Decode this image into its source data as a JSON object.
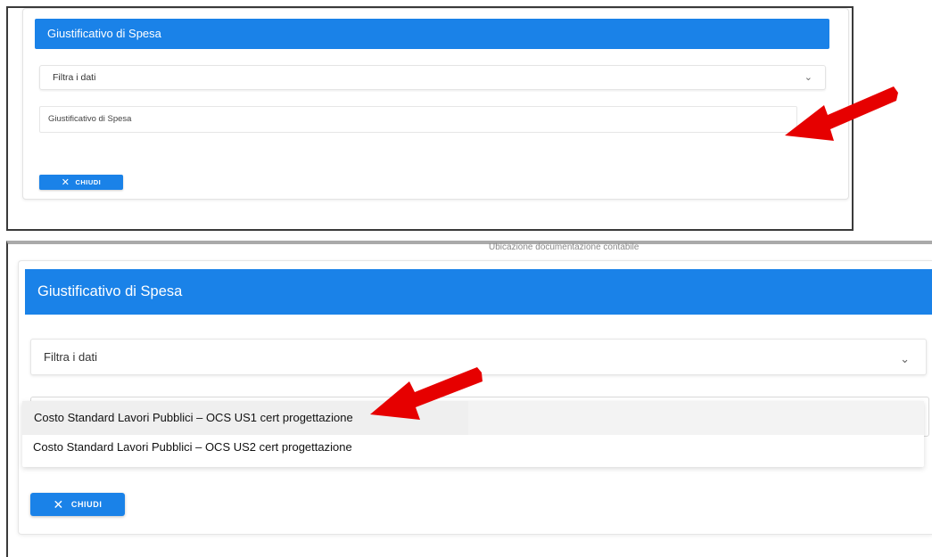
{
  "top_panel": {
    "header_title": "Giustificativo di Spesa",
    "filter_label": "Filtra i dati",
    "select_placeholder": "Giustificativo di Spesa",
    "close_label": "CHIUDI"
  },
  "bottom_panel": {
    "caption": "Ubicazione documentazione contabile",
    "header_title": "Giustificativo di Spesa",
    "filter_label": "Filtra i dati",
    "dropdown_options": [
      "Costo Standard Lavori Pubblici – OCS US1 cert progettazione",
      "Costo Standard Lavori Pubblici – OCS US2 cert progettazione"
    ],
    "highlighted_option_index": 0,
    "close_label": "CHIUDI"
  },
  "icons": {
    "chevron": "chevron-down-icon",
    "close": "close-icon",
    "annotation": "red-arrow-icon"
  },
  "colors": {
    "primary": "#1a82e8",
    "annotation_arrow": "#e60000",
    "highlight_row": "#efefef"
  }
}
